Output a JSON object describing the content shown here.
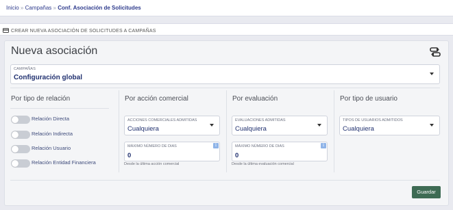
{
  "breadcrumb": {
    "home": "Inicio",
    "separator": "»",
    "parent": "Campañas",
    "current": "Conf. Asociación de Solicitudes"
  },
  "section": {
    "title": "CREAR NUEVA ASOCIACIÓN DE SOLICITUDES A CAMPAÑAS",
    "icon": "card-icon"
  },
  "form": {
    "title": "Nueva asociación",
    "title_icon": "swap-icon",
    "campaign": {
      "label": "CAMPAÑAS",
      "value": "Configuración global"
    },
    "columns": {
      "relation": {
        "heading": "Por tipo de relación",
        "toggles": [
          {
            "label": "Relación Directa",
            "on": false
          },
          {
            "label": "Relación Indirecta",
            "on": false
          },
          {
            "label": "Relación Usuario",
            "on": false
          },
          {
            "label": "Relación Entidad Financiera",
            "on": false
          }
        ]
      },
      "commercial": {
        "heading": "Por acción comercial",
        "select_label": "ACCIONES COMERCIALES ADMITIDAS",
        "select_value": "Cualquiera",
        "days_label": "MÁXIMO NÚMERO DE DIAS",
        "days_value": "0",
        "help": "Desde la última acción comercial"
      },
      "evaluation": {
        "heading": "Por evaluación",
        "select_label": "EVALUACIONES ADMITIDAS",
        "select_value": "Cualquiera",
        "days_label": "MÁXIMO NÚMERO DE DIAS",
        "days_value": "0",
        "help": "Desde la última evaluación comercial"
      },
      "user_type": {
        "heading": "Por tipo de usuario",
        "select_label": "TIPOS DE USUARIOS ADMITIDOS",
        "select_value": "Cualquiera"
      }
    },
    "info_glyph": "i",
    "save_label": "Guardar"
  },
  "colors": {
    "accent": "#2d3a8c",
    "save_button": "#3e6b54",
    "info_badge": "#8fb4e8",
    "toggle_off": "#c9cdd4"
  }
}
